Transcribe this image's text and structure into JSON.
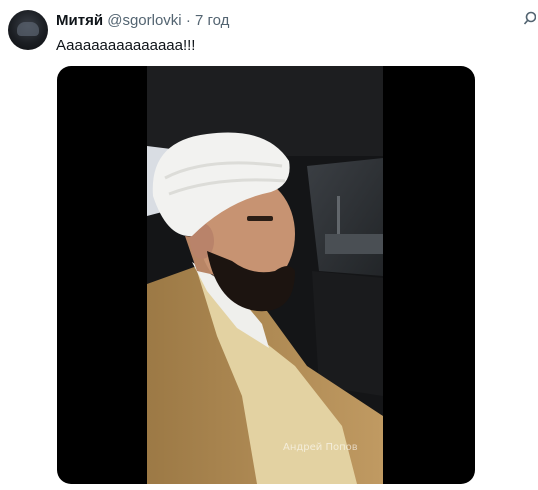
{
  "tweet": {
    "author_name": "Митяй",
    "author_handle": "@sgorlovki",
    "separator": "·",
    "time": "7 год",
    "text": "Ааааааааааааааа!!!",
    "avatar_icon": "user-avatar-icon",
    "menu_icon": "more-options-icon"
  },
  "media": {
    "watermark": "Андрей Попов",
    "colors": {
      "turban": "#f2f2f0",
      "robe_outer": "#b08a53",
      "robe_inner": "#e6d6a8",
      "beard": "#1c1410",
      "skin": "#c79372"
    }
  }
}
